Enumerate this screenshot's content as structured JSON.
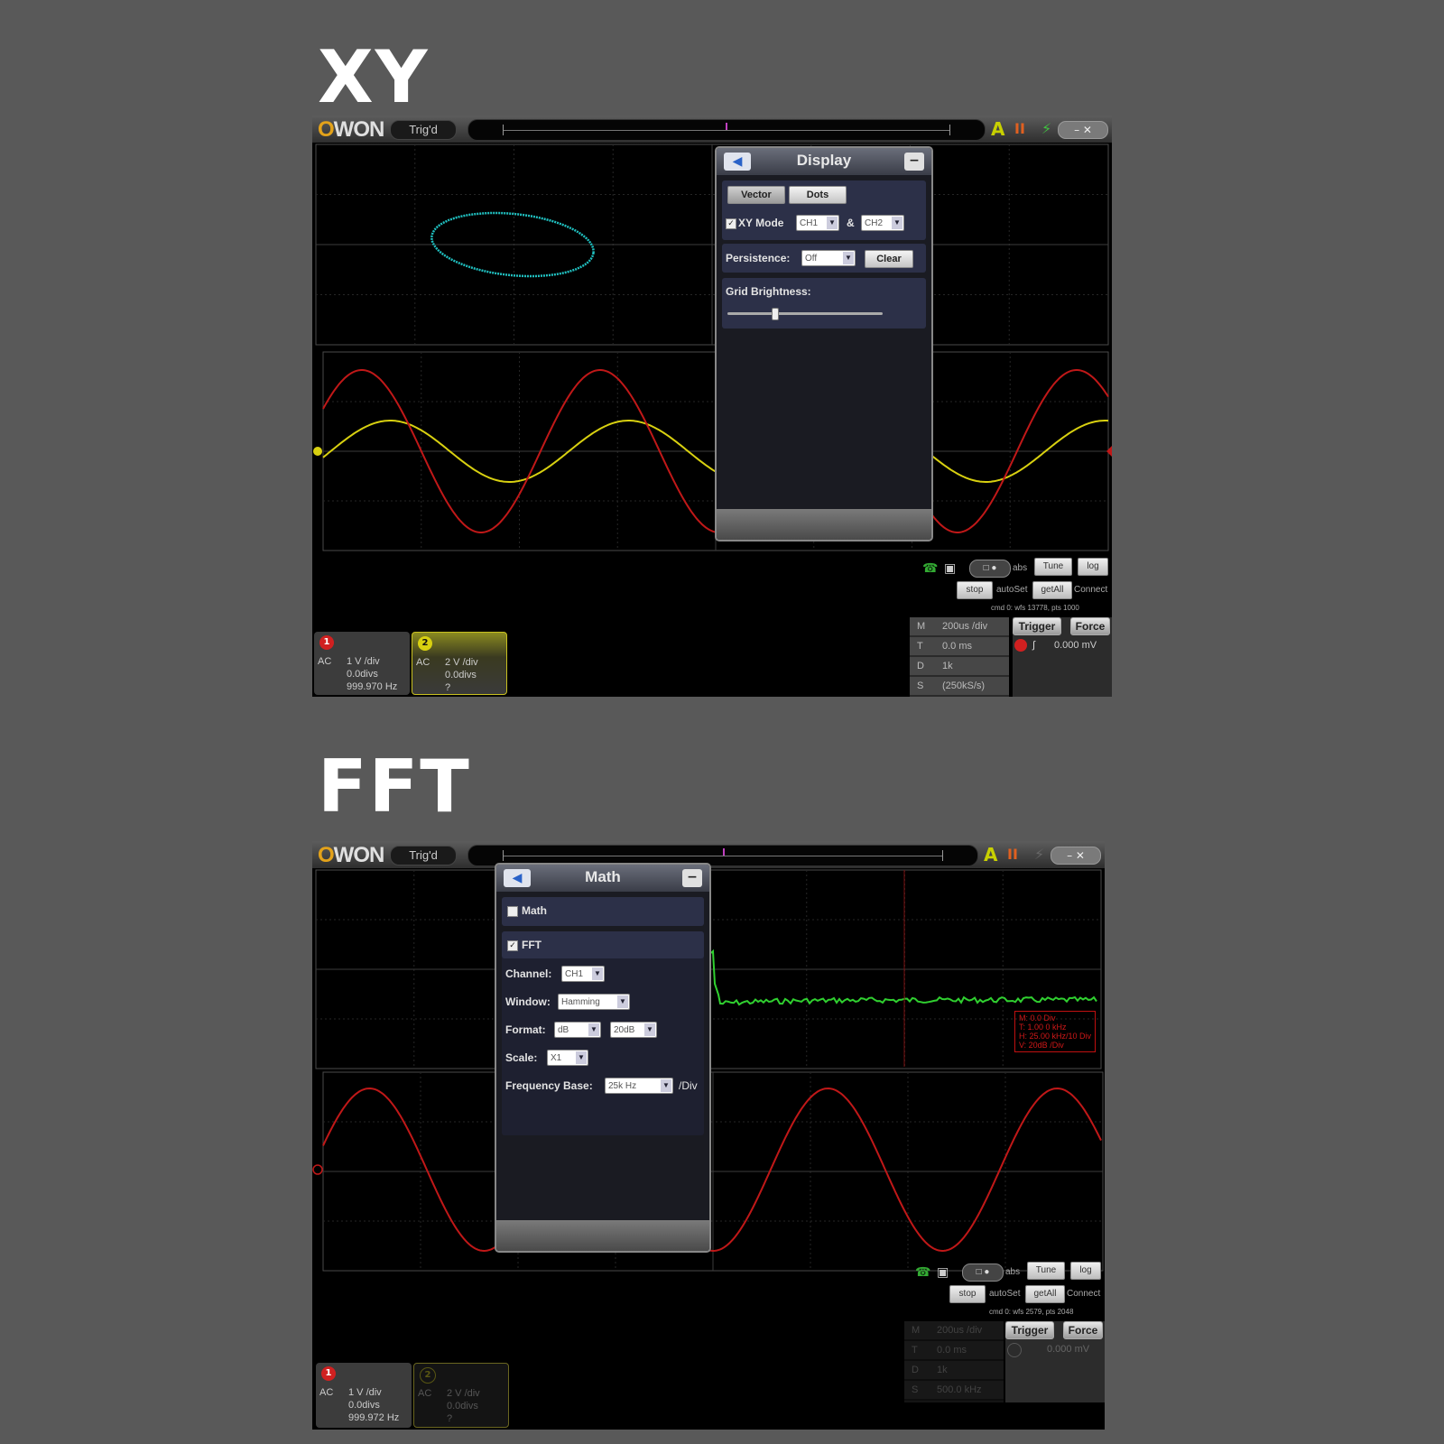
{
  "sections": {
    "xy_title": "XY",
    "fft_title": "FFT"
  },
  "app": {
    "brand_o": "O",
    "brand_rest": "WON",
    "trigger_status": "Trig'd",
    "auto_icon": "A",
    "pause_icon": "II",
    "bolt_icon": "⚡",
    "window_controls": "– ✕"
  },
  "xy": {
    "panel": {
      "title": "Display",
      "tab_vector": "Vector",
      "tab_dots": "Dots",
      "xy_mode_label": "XY Mode",
      "xy_mode_checked": "✓",
      "xy_x_channel": "CH1",
      "xy_amp": "&",
      "xy_y_channel": "CH2",
      "persistence_label": "Persistence:",
      "persistence_value": "Off",
      "clear_label": "Clear",
      "grid_brightness_label": "Grid Brightness:",
      "grid_brightness": 0.3
    },
    "controls": {
      "tune": "Tune",
      "log": "log",
      "stop": "stop",
      "autoset": "autoSet",
      "getall": "getAll",
      "connect": "Connect",
      "abs": "abs",
      "status_line": "cmd 0: wfs 13778, pts 1000"
    },
    "ch1": {
      "marker": "1",
      "coupling": "AC",
      "scale": "1 V /div",
      "offset": "0.0divs",
      "freq": "999.970 Hz"
    },
    "ch2": {
      "marker": "2",
      "coupling": "AC",
      "scale": "2 V /div",
      "offset": "0.0divs",
      "freq": "?"
    },
    "timebase": {
      "rows": [
        {
          "k": "M",
          "v": "200us /div"
        },
        {
          "k": "T",
          "v": "0.0 ms"
        },
        {
          "k": "D",
          "v": "1k"
        },
        {
          "k": "S",
          "v": "(250kS/s)"
        }
      ]
    },
    "trigger": {
      "trigger_label": "Trigger",
      "force_label": "Force",
      "level": "0.000 mV"
    },
    "colors": {
      "ch1": "#c01818",
      "ch2": "#d8d010",
      "xy": "#20c0c0"
    }
  },
  "fft": {
    "panel": {
      "title": "Math",
      "math_label": "Math",
      "fft_label": "FFT",
      "fft_checked": "✓",
      "channel_label": "Channel:",
      "channel_value": "CH1",
      "window_label": "Window:",
      "window_value": "Hamming",
      "format_label": "Format:",
      "format_value": "dB",
      "format_scale": "20dB",
      "scale_label": "Scale:",
      "scale_value": "X1",
      "freq_base_label": "Frequency Base:",
      "freq_base_value": "25k Hz",
      "per_div": "/Div"
    },
    "readout": [
      "M: 0.0 Div",
      "T: 1.00 0 kHz",
      "H: 25.00 kHz/10 Div",
      "V: 20dB /Div"
    ],
    "controls": {
      "tune": "Tune",
      "log": "log",
      "stop": "stop",
      "autoset": "autoSet",
      "getall": "getAll",
      "connect": "Connect",
      "abs": "abs",
      "status_line": "cmd 0: wfs 2579, pts 2048"
    },
    "ch1": {
      "marker": "1",
      "coupling": "AC",
      "scale": "1 V /div",
      "offset": "0.0divs",
      "freq": "999.972 Hz"
    },
    "ch2": {
      "marker": "2",
      "coupling": "AC",
      "scale": "2 V /div",
      "offset": "0.0divs",
      "freq": "?"
    },
    "timebase": {
      "rows": [
        {
          "k": "M",
          "v": "200us /div"
        },
        {
          "k": "T",
          "v": "0.0 ms"
        },
        {
          "k": "D",
          "v": "1k"
        },
        {
          "k": "S",
          "v": "500.0 kHz"
        }
      ]
    },
    "trigger": {
      "trigger_label": "Trigger",
      "force_label": "Force",
      "level": "0.000 mV"
    },
    "colors": {
      "ch1": "#c01818",
      "fft": "#30d030"
    }
  }
}
